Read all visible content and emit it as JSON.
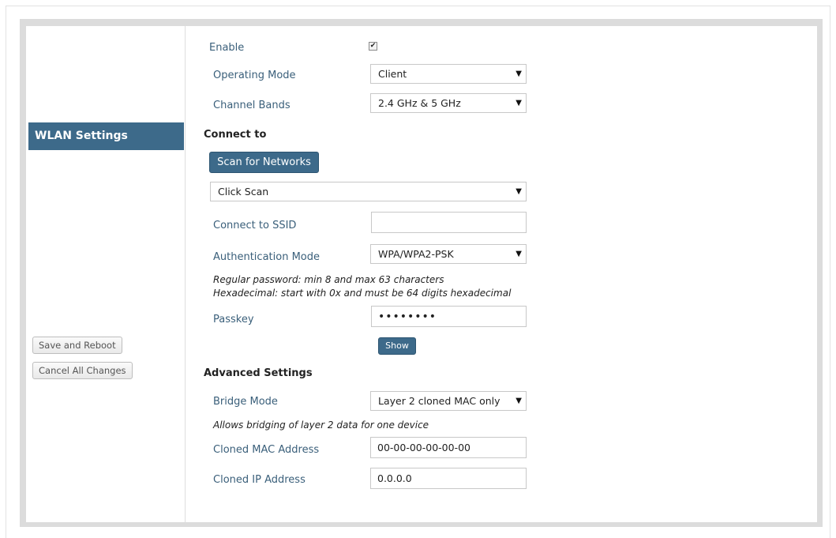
{
  "sidebar": {
    "active_item": "WLAN Settings",
    "save_reboot": "Save and Reboot",
    "cancel_changes": "Cancel All Changes"
  },
  "form": {
    "enable_label": "Enable",
    "enable_checked": true,
    "operating_mode_label": "Operating Mode",
    "operating_mode_value": "Client",
    "channel_bands_label": "Channel Bands",
    "channel_bands_value": "2.4 GHz & 5 GHz",
    "connect_to_heading": "Connect to",
    "scan_button": "Scan for Networks",
    "scan_select_value": "Click Scan",
    "ssid_label": "Connect to SSID",
    "ssid_value": "",
    "auth_mode_label": "Authentication Mode",
    "auth_mode_value": "WPA/WPA2-PSK",
    "password_note_1": "Regular password: min 8 and max 63 characters",
    "password_note_2": "Hexadecimal: start with 0x and must be 64 digits hexadecimal",
    "passkey_label": "Passkey",
    "passkey_value": "••••••••",
    "show_button": "Show",
    "advanced_heading": "Advanced Settings",
    "bridge_mode_label": "Bridge Mode",
    "bridge_mode_value": "Layer 2 cloned MAC only",
    "bridge_note": "Allows bridging of layer 2 data for one device",
    "cloned_mac_label": "Cloned MAC Address",
    "cloned_mac_value": "00-00-00-00-00-00",
    "cloned_ip_label": "Cloned IP Address",
    "cloned_ip_value": "0.0.0.0"
  },
  "icons": {
    "dropdown": "caret-down-icon",
    "checkmark": "checkmark-icon"
  },
  "colors": {
    "accent": "#3d6a8a",
    "label": "#3a5f7a"
  }
}
